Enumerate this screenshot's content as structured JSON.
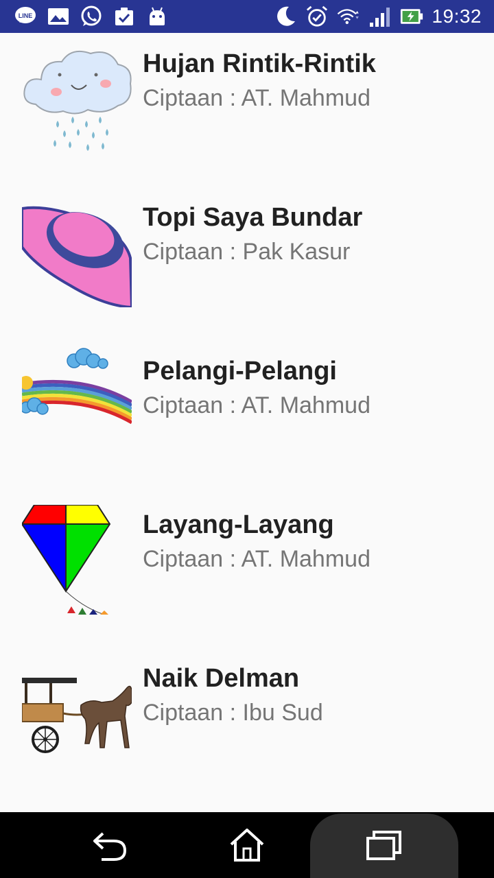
{
  "status_bar": {
    "time": "19:32",
    "left_icons": [
      "line-icon",
      "gallery-icon",
      "whatsapp-icon",
      "clipboard-check-icon",
      "android-icon"
    ],
    "right_icons": [
      "moon-icon",
      "alarm-icon",
      "wifi-icon",
      "signal-icon",
      "battery-charging-icon"
    ],
    "background": "#283593"
  },
  "songs": [
    {
      "title": "Hujan Rintik-Rintik",
      "creator": "Ciptaan : AT. Mahmud",
      "image": "rain-cloud-image"
    },
    {
      "title": "Topi Saya Bundar",
      "creator": "Ciptaan : Pak Kasur",
      "image": "round-hat-image"
    },
    {
      "title": "Pelangi-Pelangi",
      "creator": "Ciptaan : AT. Mahmud",
      "image": "rainbow-image"
    },
    {
      "title": "Layang-Layang",
      "creator": "Ciptaan : AT. Mahmud",
      "image": "kite-image"
    },
    {
      "title": "Naik Delman",
      "creator": "Ciptaan : Ibu Sud",
      "image": "horse-carriage-image"
    }
  ],
  "nav_bar": {
    "buttons": [
      "back-icon",
      "home-icon",
      "recents-icon"
    ]
  }
}
